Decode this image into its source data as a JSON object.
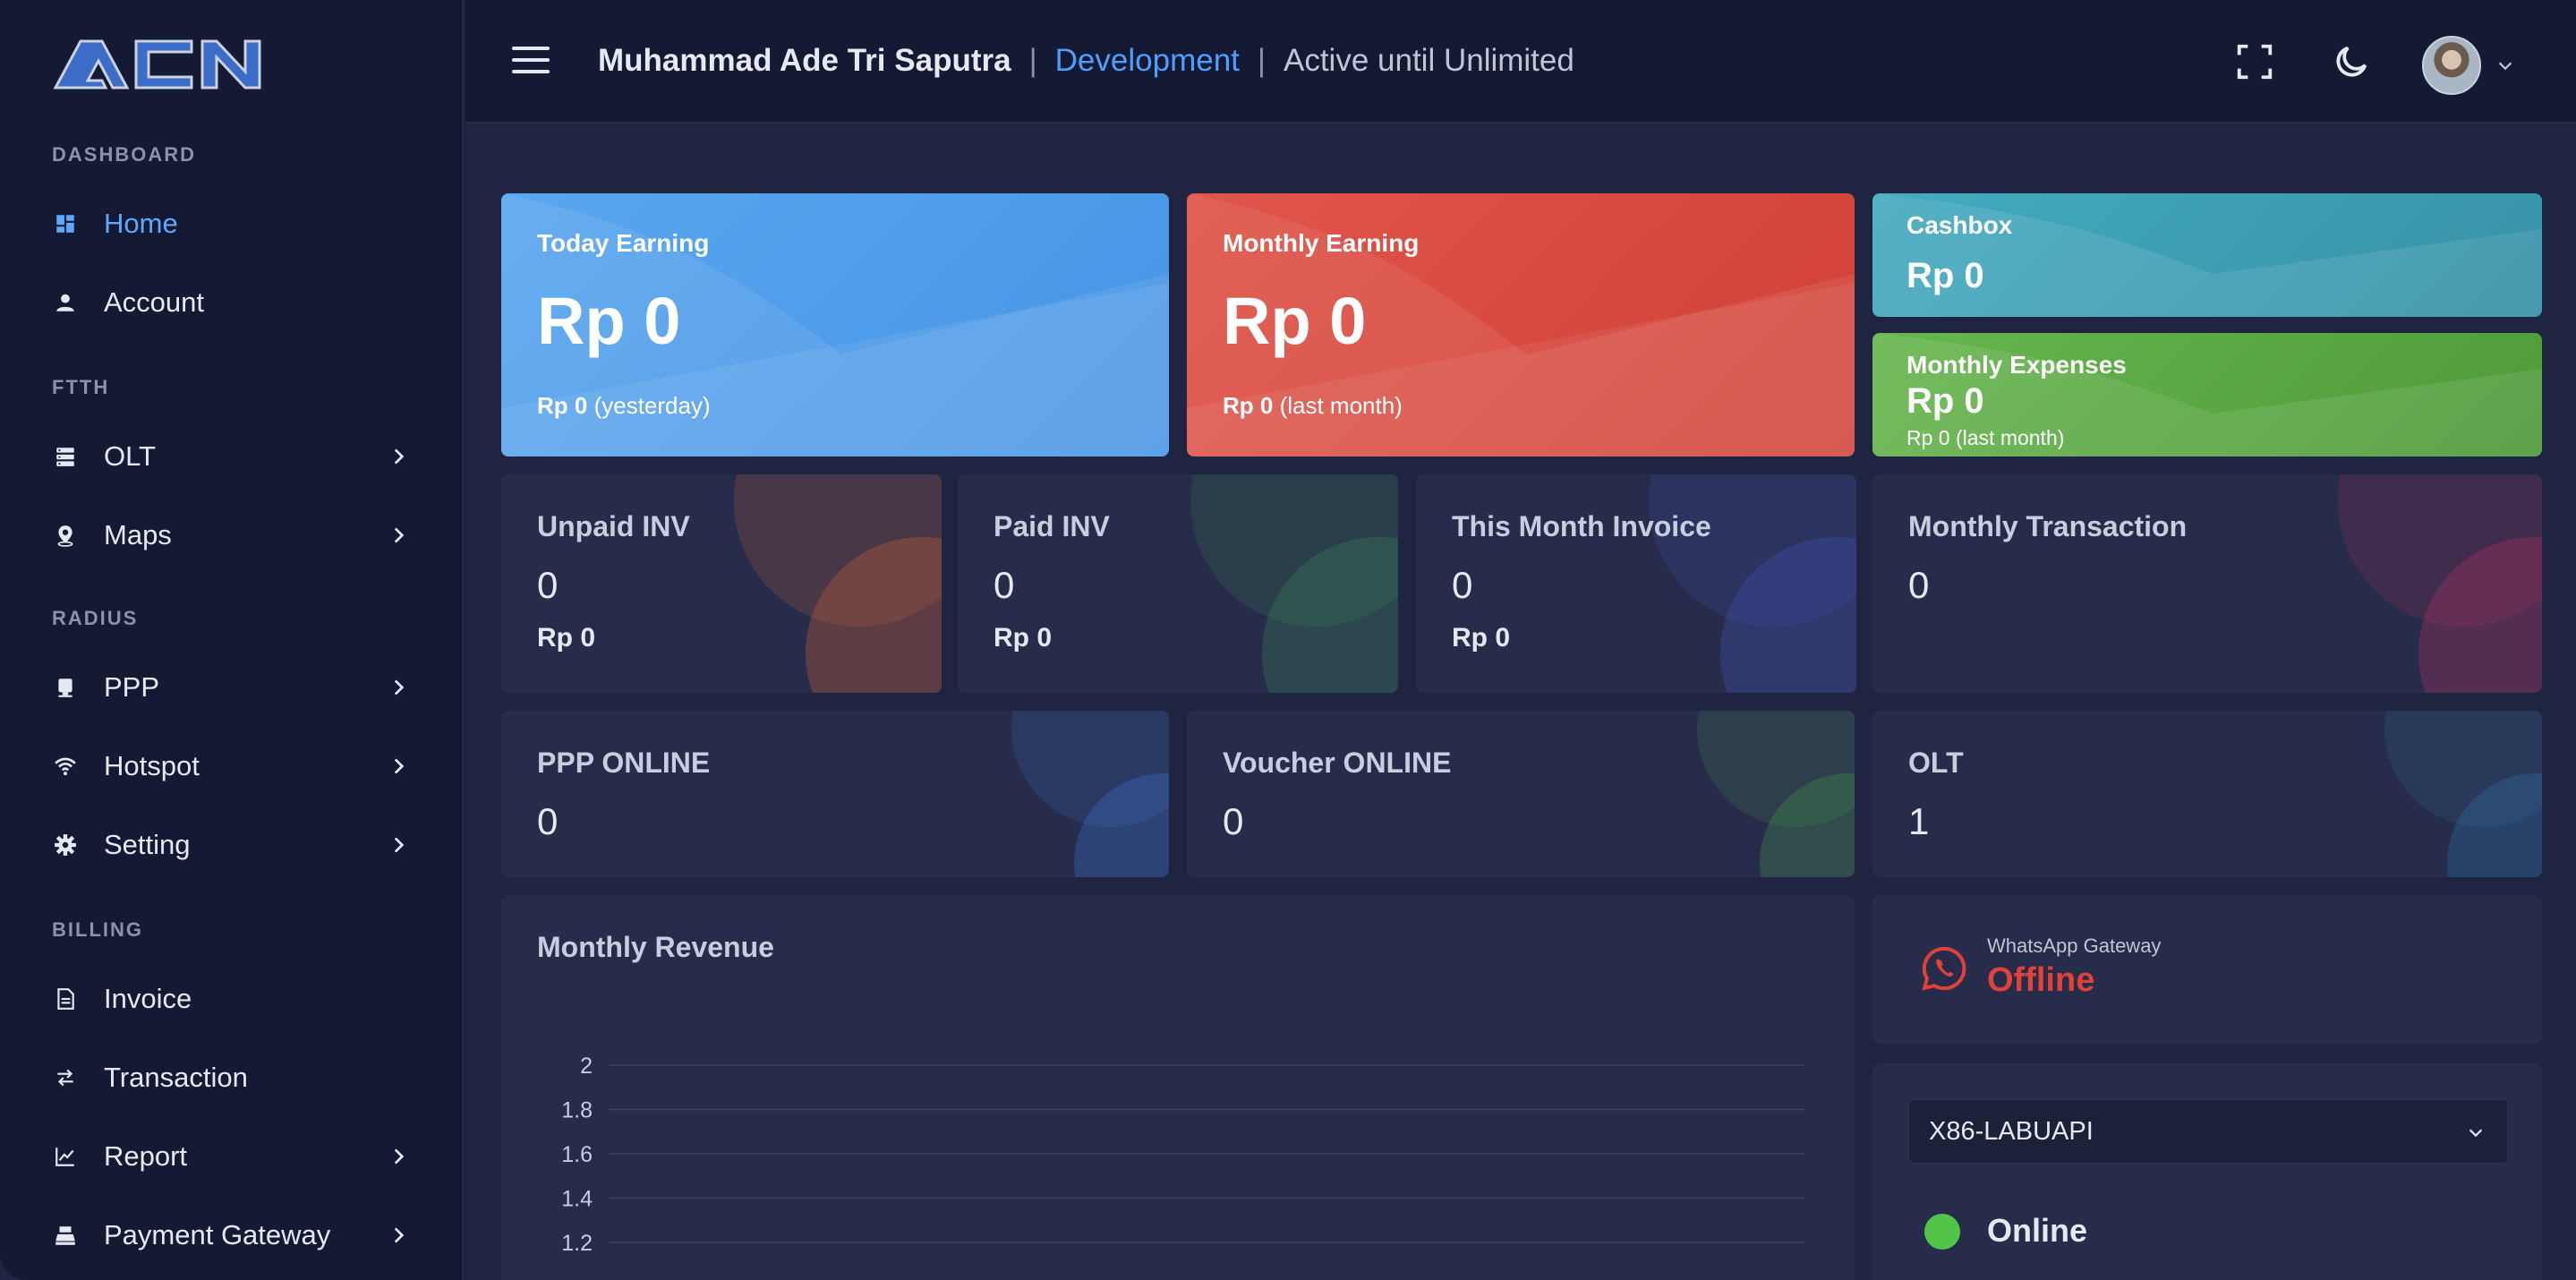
{
  "sidebar": {
    "logo_text": "ACN",
    "sections": {
      "dashboard": "DASHBOARD",
      "ftth": "FTTH",
      "radius": "RADIUS",
      "billing": "BILLING"
    },
    "items": {
      "home": "Home",
      "account": "Account",
      "olt": "OLT",
      "maps": "Maps",
      "ppp": "PPP",
      "hotspot": "Hotspot",
      "setting": "Setting",
      "invoice": "Invoice",
      "transaction": "Transaction",
      "report": "Report",
      "payment_gateway": "Payment Gateway"
    }
  },
  "topbar": {
    "user_name": "Muhammad Ade Tri Saputra",
    "separator": "|",
    "environment": "Development",
    "active_text": "Active until Unlimited"
  },
  "cards": {
    "today_earning": {
      "title": "Today Earning",
      "value": "Rp 0",
      "sub_value": "Rp 0",
      "sub_label": "(yesterday)"
    },
    "monthly_earning": {
      "title": "Monthly Earning",
      "value": "Rp 0",
      "sub_value": "Rp 0",
      "sub_label": "(last month)"
    },
    "cashbox": {
      "title": "Cashbox",
      "value": "Rp 0"
    },
    "monthly_expenses": {
      "title": "Monthly Expenses",
      "value": "Rp 0",
      "sub": "Rp 0 (last month)"
    },
    "unpaid_inv": {
      "title": "Unpaid INV",
      "count": "0",
      "amount": "Rp 0"
    },
    "paid_inv": {
      "title": "Paid INV",
      "count": "0",
      "amount": "Rp 0"
    },
    "this_month_invoice": {
      "title": "This Month Invoice",
      "count": "0",
      "amount": "Rp 0"
    },
    "monthly_transaction": {
      "title": "Monthly Transaction",
      "count": "0"
    },
    "ppp_online": {
      "title": "PPP ONLINE",
      "count": "0"
    },
    "voucher_online": {
      "title": "Voucher ONLINE",
      "count": "0"
    },
    "olt": {
      "title": "OLT",
      "count": "1"
    }
  },
  "whatsapp": {
    "label": "WhatsApp Gateway",
    "status": "Offline"
  },
  "router": {
    "selected": "X86-LABUAPI",
    "status": "Online"
  },
  "colors": {
    "today": "#4e9ae8",
    "monthly": "#d9453b",
    "cashbox": "#3ea3b5",
    "expenses": "#5ba843",
    "offline": "#e0423a",
    "online": "#52c44a",
    "accent": "#4e9fff"
  },
  "chart_data": {
    "type": "line",
    "title": "Monthly Revenue",
    "y_ticks": [
      "2",
      "1.8",
      "1.6",
      "1.4",
      "1.2"
    ],
    "series": []
  }
}
